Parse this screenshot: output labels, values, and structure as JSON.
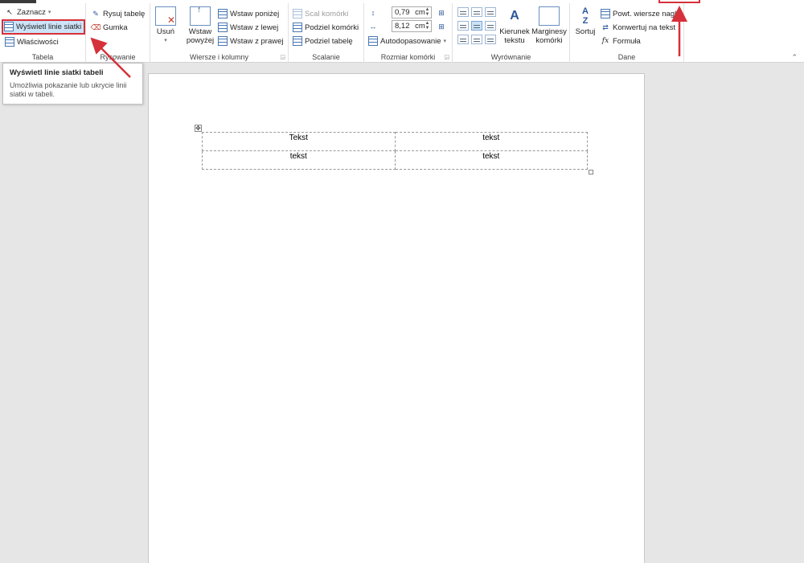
{
  "ribbon": {
    "tabela": {
      "label": "Tabela",
      "zaznacz": "Zaznacz",
      "wyswietl_linie": "Wyświetl linie siatki",
      "wlasciwosci": "Właściwości"
    },
    "rysowanie": {
      "label": "Rysowanie",
      "rysuj": "Rysuj tabelę",
      "gumka": "Gumka"
    },
    "wiersze": {
      "label": "Wiersze i kolumny",
      "usun": "Usuń",
      "wstaw_powyzej_1": "Wstaw",
      "wstaw_powyzej_2": "powyżej",
      "wstaw_ponizej": "Wstaw poniżej",
      "wstaw_lewej": "Wstaw z lewej",
      "wstaw_prawej": "Wstaw z prawej"
    },
    "scalanie": {
      "label": "Scalanie",
      "scal": "Scal komórki",
      "podziel_komorki": "Podziel komórki",
      "podziel_tabele": "Podziel tabelę"
    },
    "rozmiar": {
      "label": "Rozmiar komórki",
      "height_value": "0,79",
      "width_value": "8,12",
      "unit": "cm",
      "autodopasowanie": "Autodopasowanie"
    },
    "wyrownanie": {
      "label": "Wyrównanie",
      "kierunek_1": "Kierunek",
      "kierunek_2": "tekstu",
      "marginesy_1": "Marginesy",
      "marginesy_2": "komórki"
    },
    "dane": {
      "label": "Dane",
      "sortuj": "Sortuj",
      "powt": "Powt. wiersze nagł",
      "konwertuj": "Konwertuj na tekst",
      "formula": "Formuła"
    }
  },
  "tooltip": {
    "title": "Wyświetl linie siatki tabeli",
    "body": "Umożliwia pokazanie lub ukrycie linii siatki w tabeli."
  },
  "document": {
    "table": [
      [
        "Tekst",
        "tekst"
      ],
      [
        "tekst",
        "tekst"
      ]
    ]
  },
  "colors": {
    "highlight": "#d6303a",
    "accent": "#2b579a"
  }
}
